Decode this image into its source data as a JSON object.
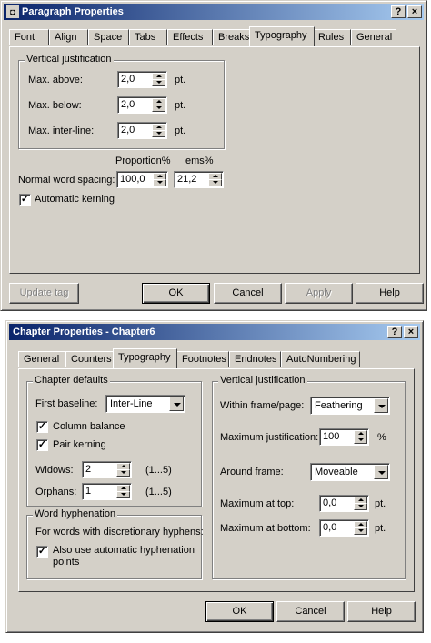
{
  "paragraph_dialog": {
    "title": "Paragraph Properties",
    "title_buttons": {
      "help": "?",
      "close": "×"
    },
    "tabs": [
      "Font",
      "Align",
      "Space",
      "Tabs",
      "Effects",
      "Breaks",
      "Typography",
      "Rules",
      "General"
    ],
    "selected_tab": "Typography",
    "vertical_justification": {
      "title": "Vertical justification",
      "max_above": {
        "label": "Max. above:",
        "value": "2,0",
        "unit": "pt."
      },
      "max_below": {
        "label": "Max. below:",
        "value": "2,0",
        "unit": "pt."
      },
      "max_interline": {
        "label": "Max. inter-line:",
        "value": "2,0",
        "unit": "pt."
      }
    },
    "word_spacing": {
      "proportion_header": "Proportion%",
      "ems_header": "ems%",
      "label": "Normal word spacing:",
      "proportion_value": "100,0",
      "ems_value": "21,2"
    },
    "automatic_kerning": {
      "label": "Automatic kerning",
      "checked": true
    },
    "buttons": {
      "update_tag": "Update tag",
      "ok": "OK",
      "cancel": "Cancel",
      "apply": "Apply",
      "help": "Help"
    }
  },
  "chapter_dialog": {
    "title": "Chapter Properties - Chapter6",
    "title_buttons": {
      "help": "?",
      "close": "×"
    },
    "tabs": [
      "General",
      "Counters",
      "Typography",
      "Footnotes",
      "Endnotes",
      "AutoNumbering"
    ],
    "selected_tab": "Typography",
    "chapter_defaults": {
      "title": "Chapter defaults",
      "first_baseline": {
        "label": "First baseline:",
        "value": "Inter-Line"
      },
      "column_balance": {
        "label": "Column balance",
        "checked": true
      },
      "pair_kerning": {
        "label": "Pair kerning",
        "checked": true
      },
      "widows": {
        "label": "Widows:",
        "value": "2",
        "range": "(1...5)"
      },
      "orphans": {
        "label": "Orphans:",
        "value": "1",
        "range": "(1...5)"
      }
    },
    "word_hyphenation": {
      "title": "Word hyphenation",
      "description": "For words with discretionary hyphens:",
      "auto_hyphenation": {
        "label_line1": "Also use automatic hyphenation",
        "label_line2": "points",
        "checked": true
      }
    },
    "vertical_justification": {
      "title": "Vertical justification",
      "within_frame": {
        "label": "Within frame/page:",
        "value": "Feathering"
      },
      "max_justification": {
        "label": "Maximum justification:",
        "value": "100",
        "unit": "%"
      },
      "around_frame": {
        "label": "Around frame:",
        "value": "Moveable"
      },
      "max_top": {
        "label": "Maximum at top:",
        "value": "0,0",
        "unit": "pt."
      },
      "max_bottom": {
        "label": "Maximum at bottom:",
        "value": "0,0",
        "unit": "pt."
      }
    },
    "buttons": {
      "ok": "OK",
      "cancel": "Cancel",
      "help": "Help"
    }
  },
  "colors": {
    "face": "#d4d0c8",
    "title_start": "#0a246a",
    "title_end": "#a6caf0"
  }
}
